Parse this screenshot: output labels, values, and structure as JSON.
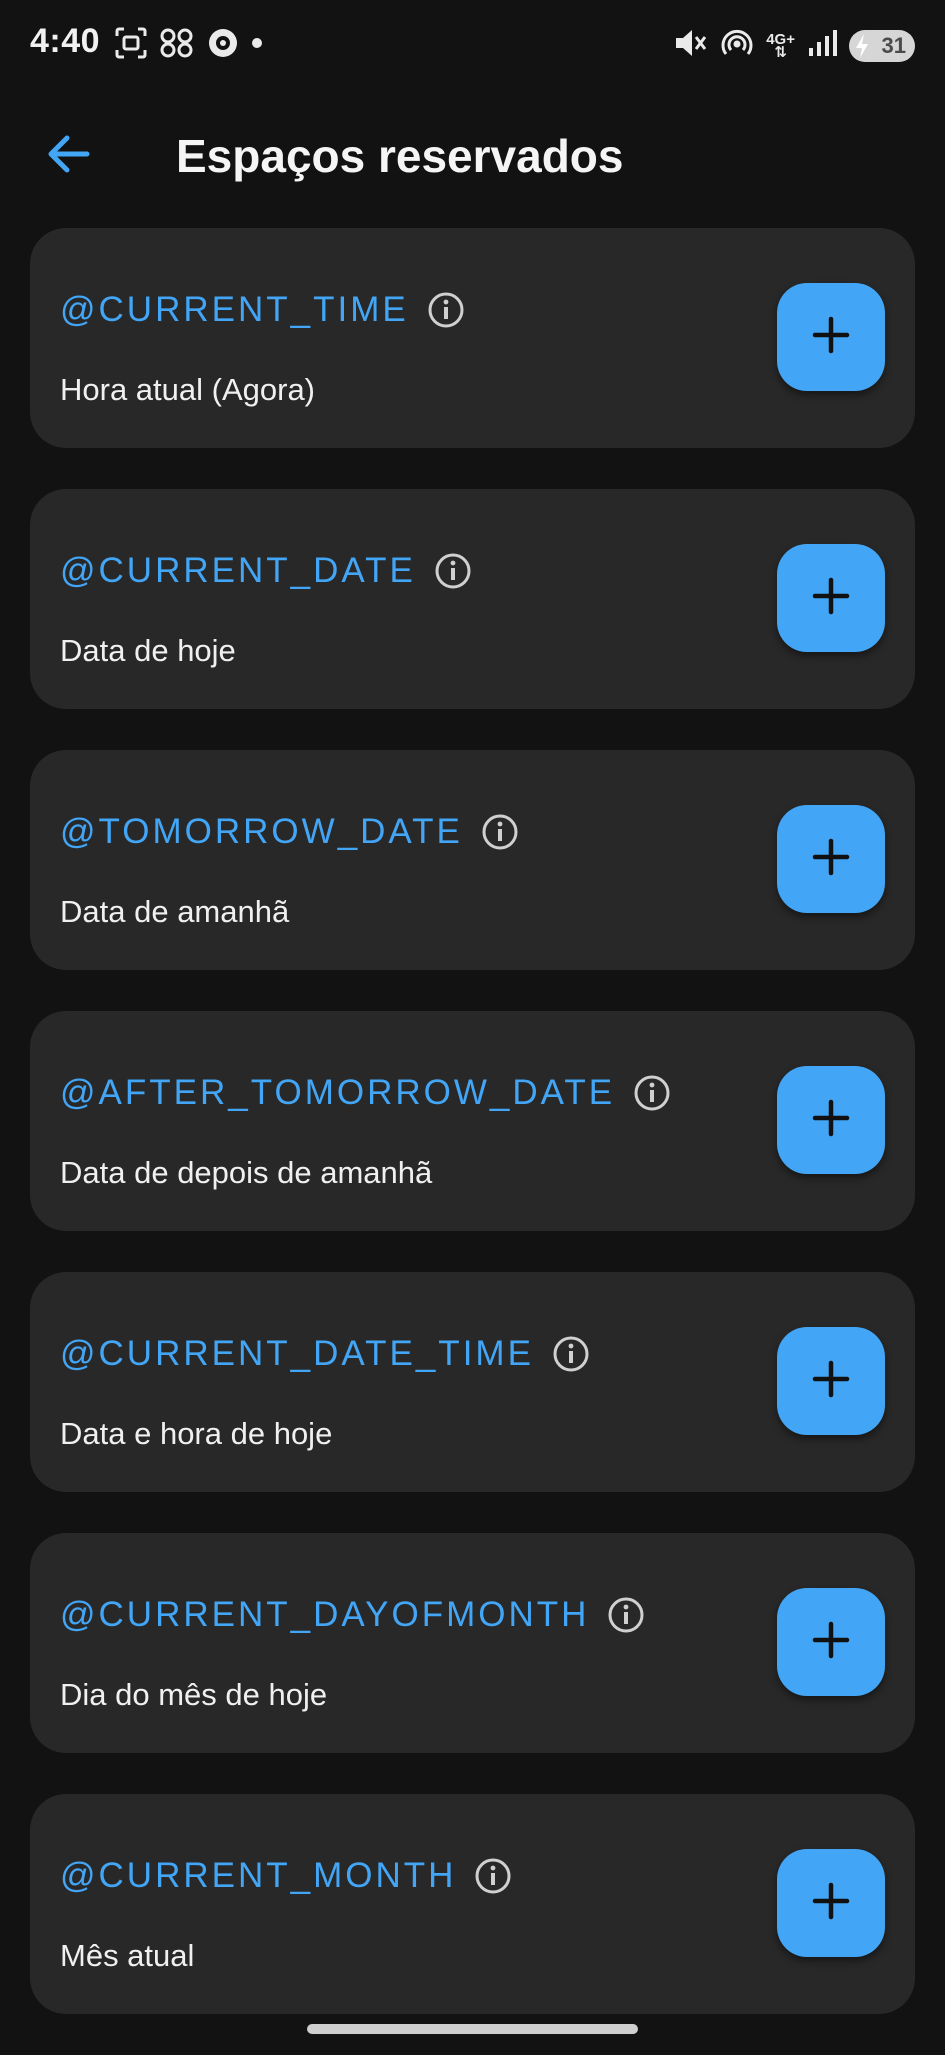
{
  "status_bar": {
    "time": "4:40",
    "network": "4G+",
    "battery": "31"
  },
  "app_bar": {
    "title": "Espaços reservados"
  },
  "placeholders": [
    {
      "name": "@CURRENT_TIME",
      "description": "Hora atual (Agora)"
    },
    {
      "name": "@CURRENT_DATE",
      "description": "Data de hoje"
    },
    {
      "name": "@TOMORROW_DATE",
      "description": "Data de amanhã"
    },
    {
      "name": "@AFTER_TOMORROW_DATE",
      "description": "Data de depois de amanhã"
    },
    {
      "name": "@CURRENT_DATE_TIME",
      "description": "Data e hora de hoje"
    },
    {
      "name": "@CURRENT_DAYOFMONTH",
      "description": "Dia do mês de hoje"
    },
    {
      "name": "@CURRENT_MONTH",
      "description": "Mês atual"
    }
  ],
  "colors": {
    "background": "#121212",
    "card": "#282828",
    "accent": "#42a5f5"
  }
}
